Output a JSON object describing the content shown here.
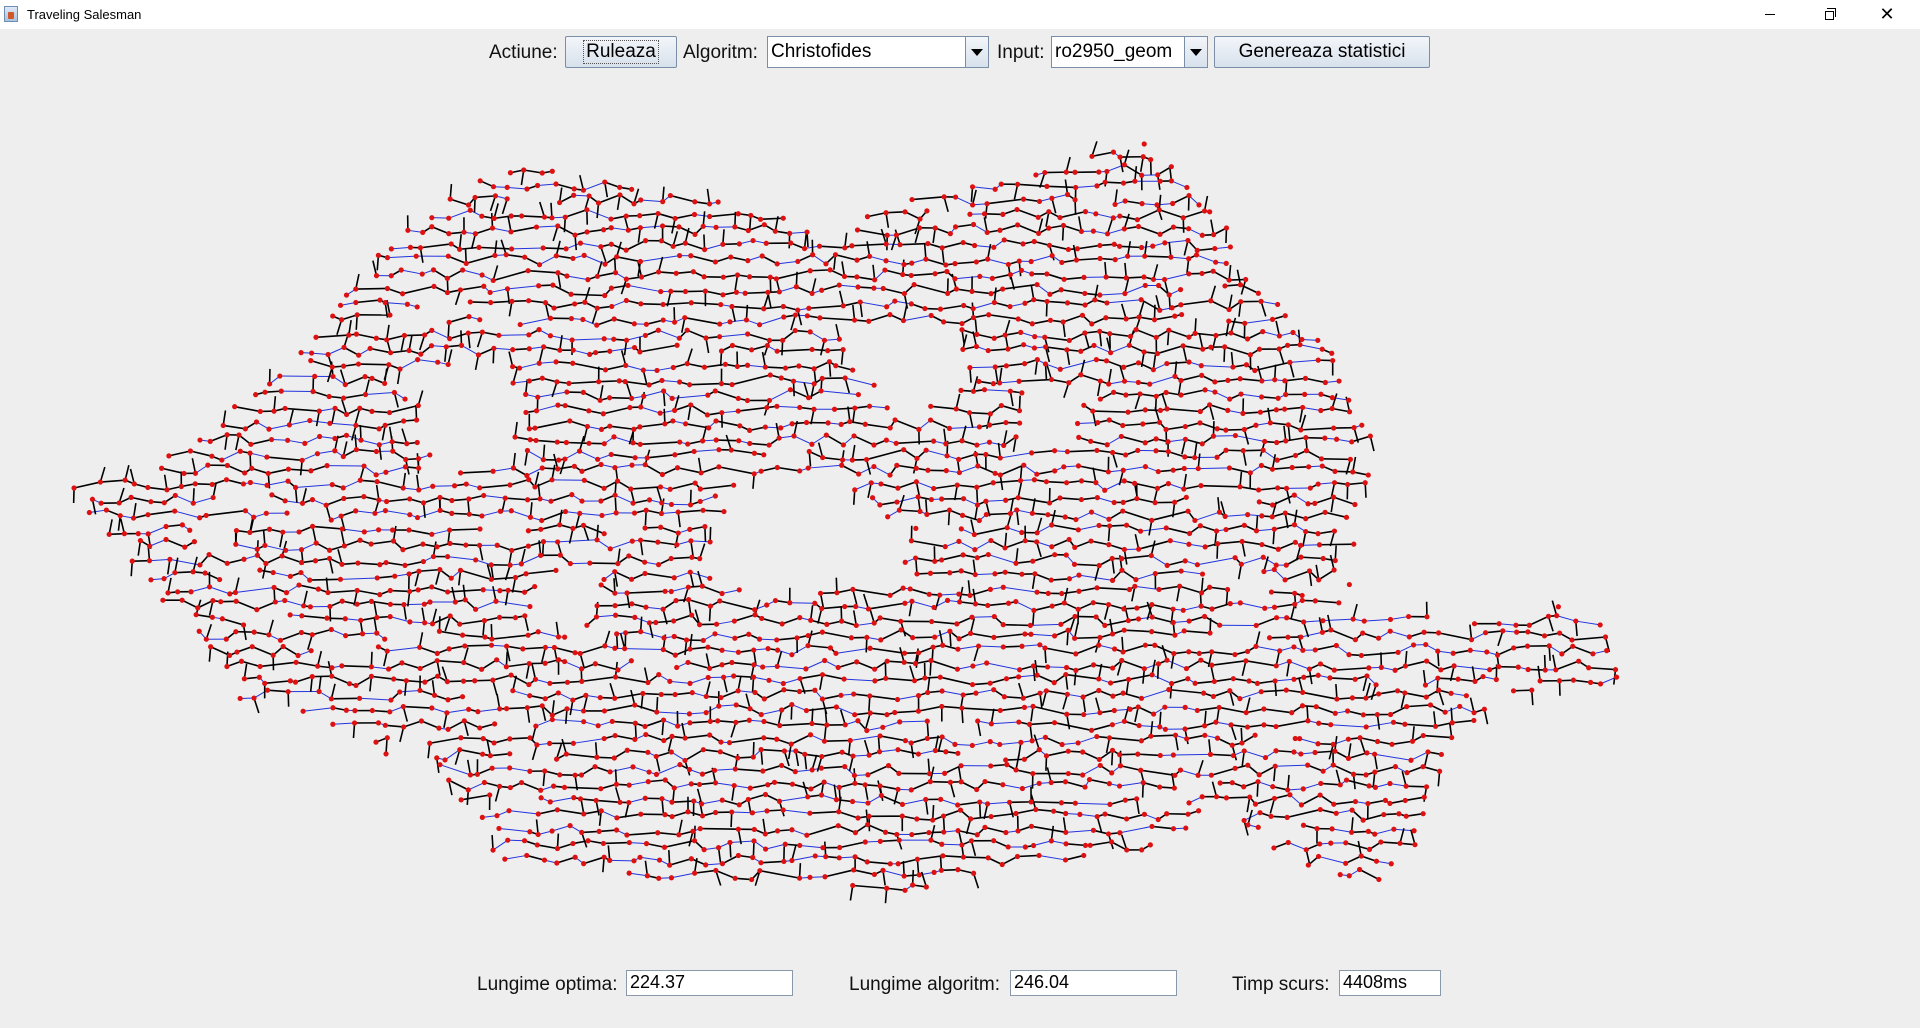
{
  "window": {
    "title": "Traveling Salesman",
    "icon": "java-icon"
  },
  "toolbar": {
    "action_label": "Actiune:",
    "run_button": "Ruleaza",
    "algorithm_label": "Algoritm:",
    "algorithm_value": "Christofides",
    "input_label": "Input:",
    "input_value": "ro2950_geom",
    "stats_button": "Genereaza statistici"
  },
  "stats": {
    "optimal_label": "Lungime optima:",
    "optimal_value": "224.37",
    "algorithm_length_label": "Lungime algoritm:",
    "algorithm_length_value": "246.04",
    "time_label": "Timp scurs:",
    "time_value": "4408ms"
  },
  "colors": {
    "city_node": "#dd1111",
    "tree_edge": "#000000",
    "tour_edge": "#2233dd",
    "background": "#eeeeee"
  }
}
